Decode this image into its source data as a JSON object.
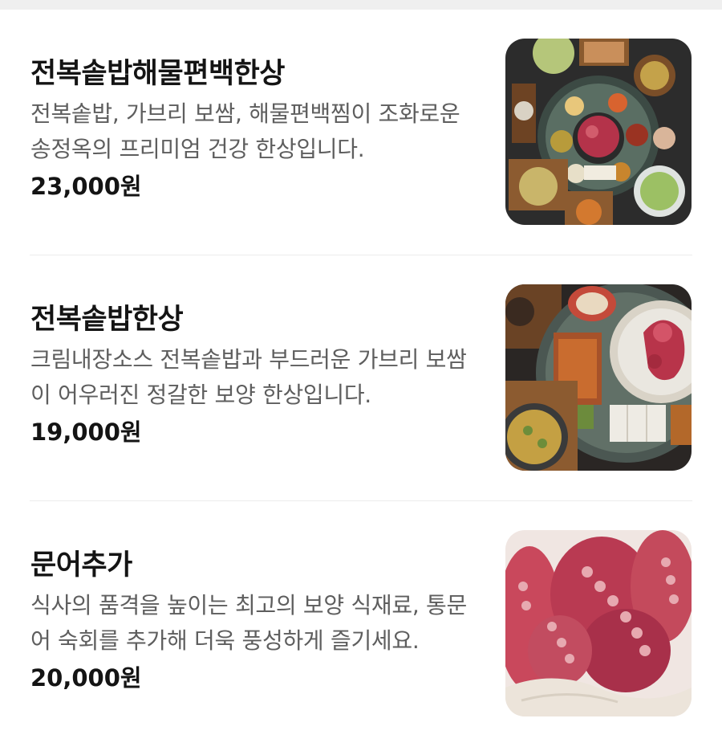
{
  "menu": {
    "items": [
      {
        "name": "전복솥밥해물편백한상",
        "description": "전복솥밥, 가브리 보쌈, 해물편백찜이 조화로운 송정옥의 프리미엄 건강 한상입니다.",
        "price": "23,000원",
        "photo": "seafood-table-photo"
      },
      {
        "name": "전복솥밥한상",
        "description": "크림내장소스 전복솥밥과 부드러운 가브리 보쌈이 어우러진 정갈한 보양 한상입니다.",
        "price": "19,000원",
        "photo": "abalone-rice-table-photo"
      },
      {
        "name": "문어추가",
        "description": "식사의 품격을 높이는 최고의 보양 식재료, 통문어 숙회를 추가해 더욱 풍성하게 즐기세요.",
        "price": "20,000원",
        "photo": "octopus-photo"
      }
    ]
  }
}
